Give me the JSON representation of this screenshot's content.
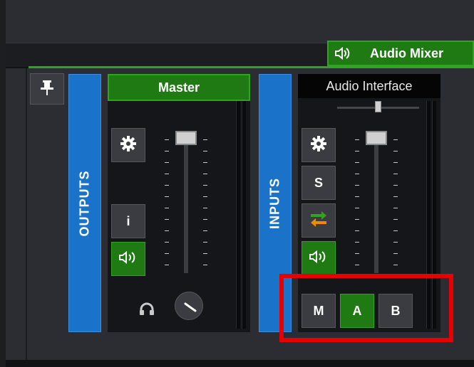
{
  "colors": {
    "accent_green": "#1f7a14",
    "accent_blue": "#1a73c8",
    "highlight_red": "#e60000"
  },
  "window": {
    "tab_label": "Audio Mixer",
    "tab_icon": "speaker-icon"
  },
  "outputs": {
    "label": "OUTPUTS"
  },
  "inputs": {
    "label": "INPUTS"
  },
  "master": {
    "title": "Master",
    "buttons": {
      "settings_icon": "gear-icon",
      "info": "i",
      "mute_icon": "speaker-icon"
    },
    "monitor_icon": "headphones-icon",
    "fader_level": 0.98
  },
  "audio_interface": {
    "title": "Audio Interface",
    "balance": 0.5,
    "buttons": {
      "settings_icon": "gear-icon",
      "solo": "S",
      "swap_icon": "swap-arrows-icon",
      "mute_icon": "speaker-icon"
    },
    "routing": {
      "m": "M",
      "a": "A",
      "b": "B",
      "active": "A"
    },
    "fader_level": 0.98
  }
}
